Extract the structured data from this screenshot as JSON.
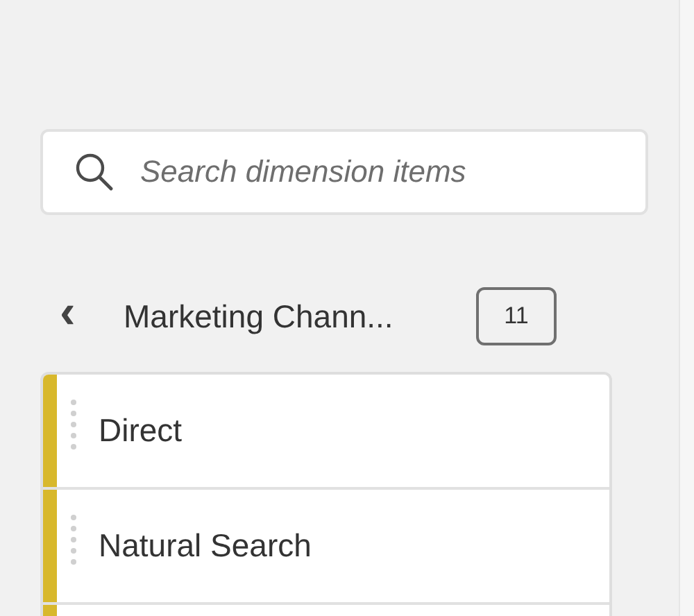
{
  "search": {
    "placeholder": "Search dimension items"
  },
  "header": {
    "back": "‹",
    "title": "Marketing Chann...",
    "count": "11"
  },
  "items": [
    {
      "label": "Direct",
      "color": "#d8b82c"
    },
    {
      "label": "Natural Search",
      "color": "#d8b82c"
    }
  ],
  "partial_row": {
    "color": "#d8b82c"
  }
}
